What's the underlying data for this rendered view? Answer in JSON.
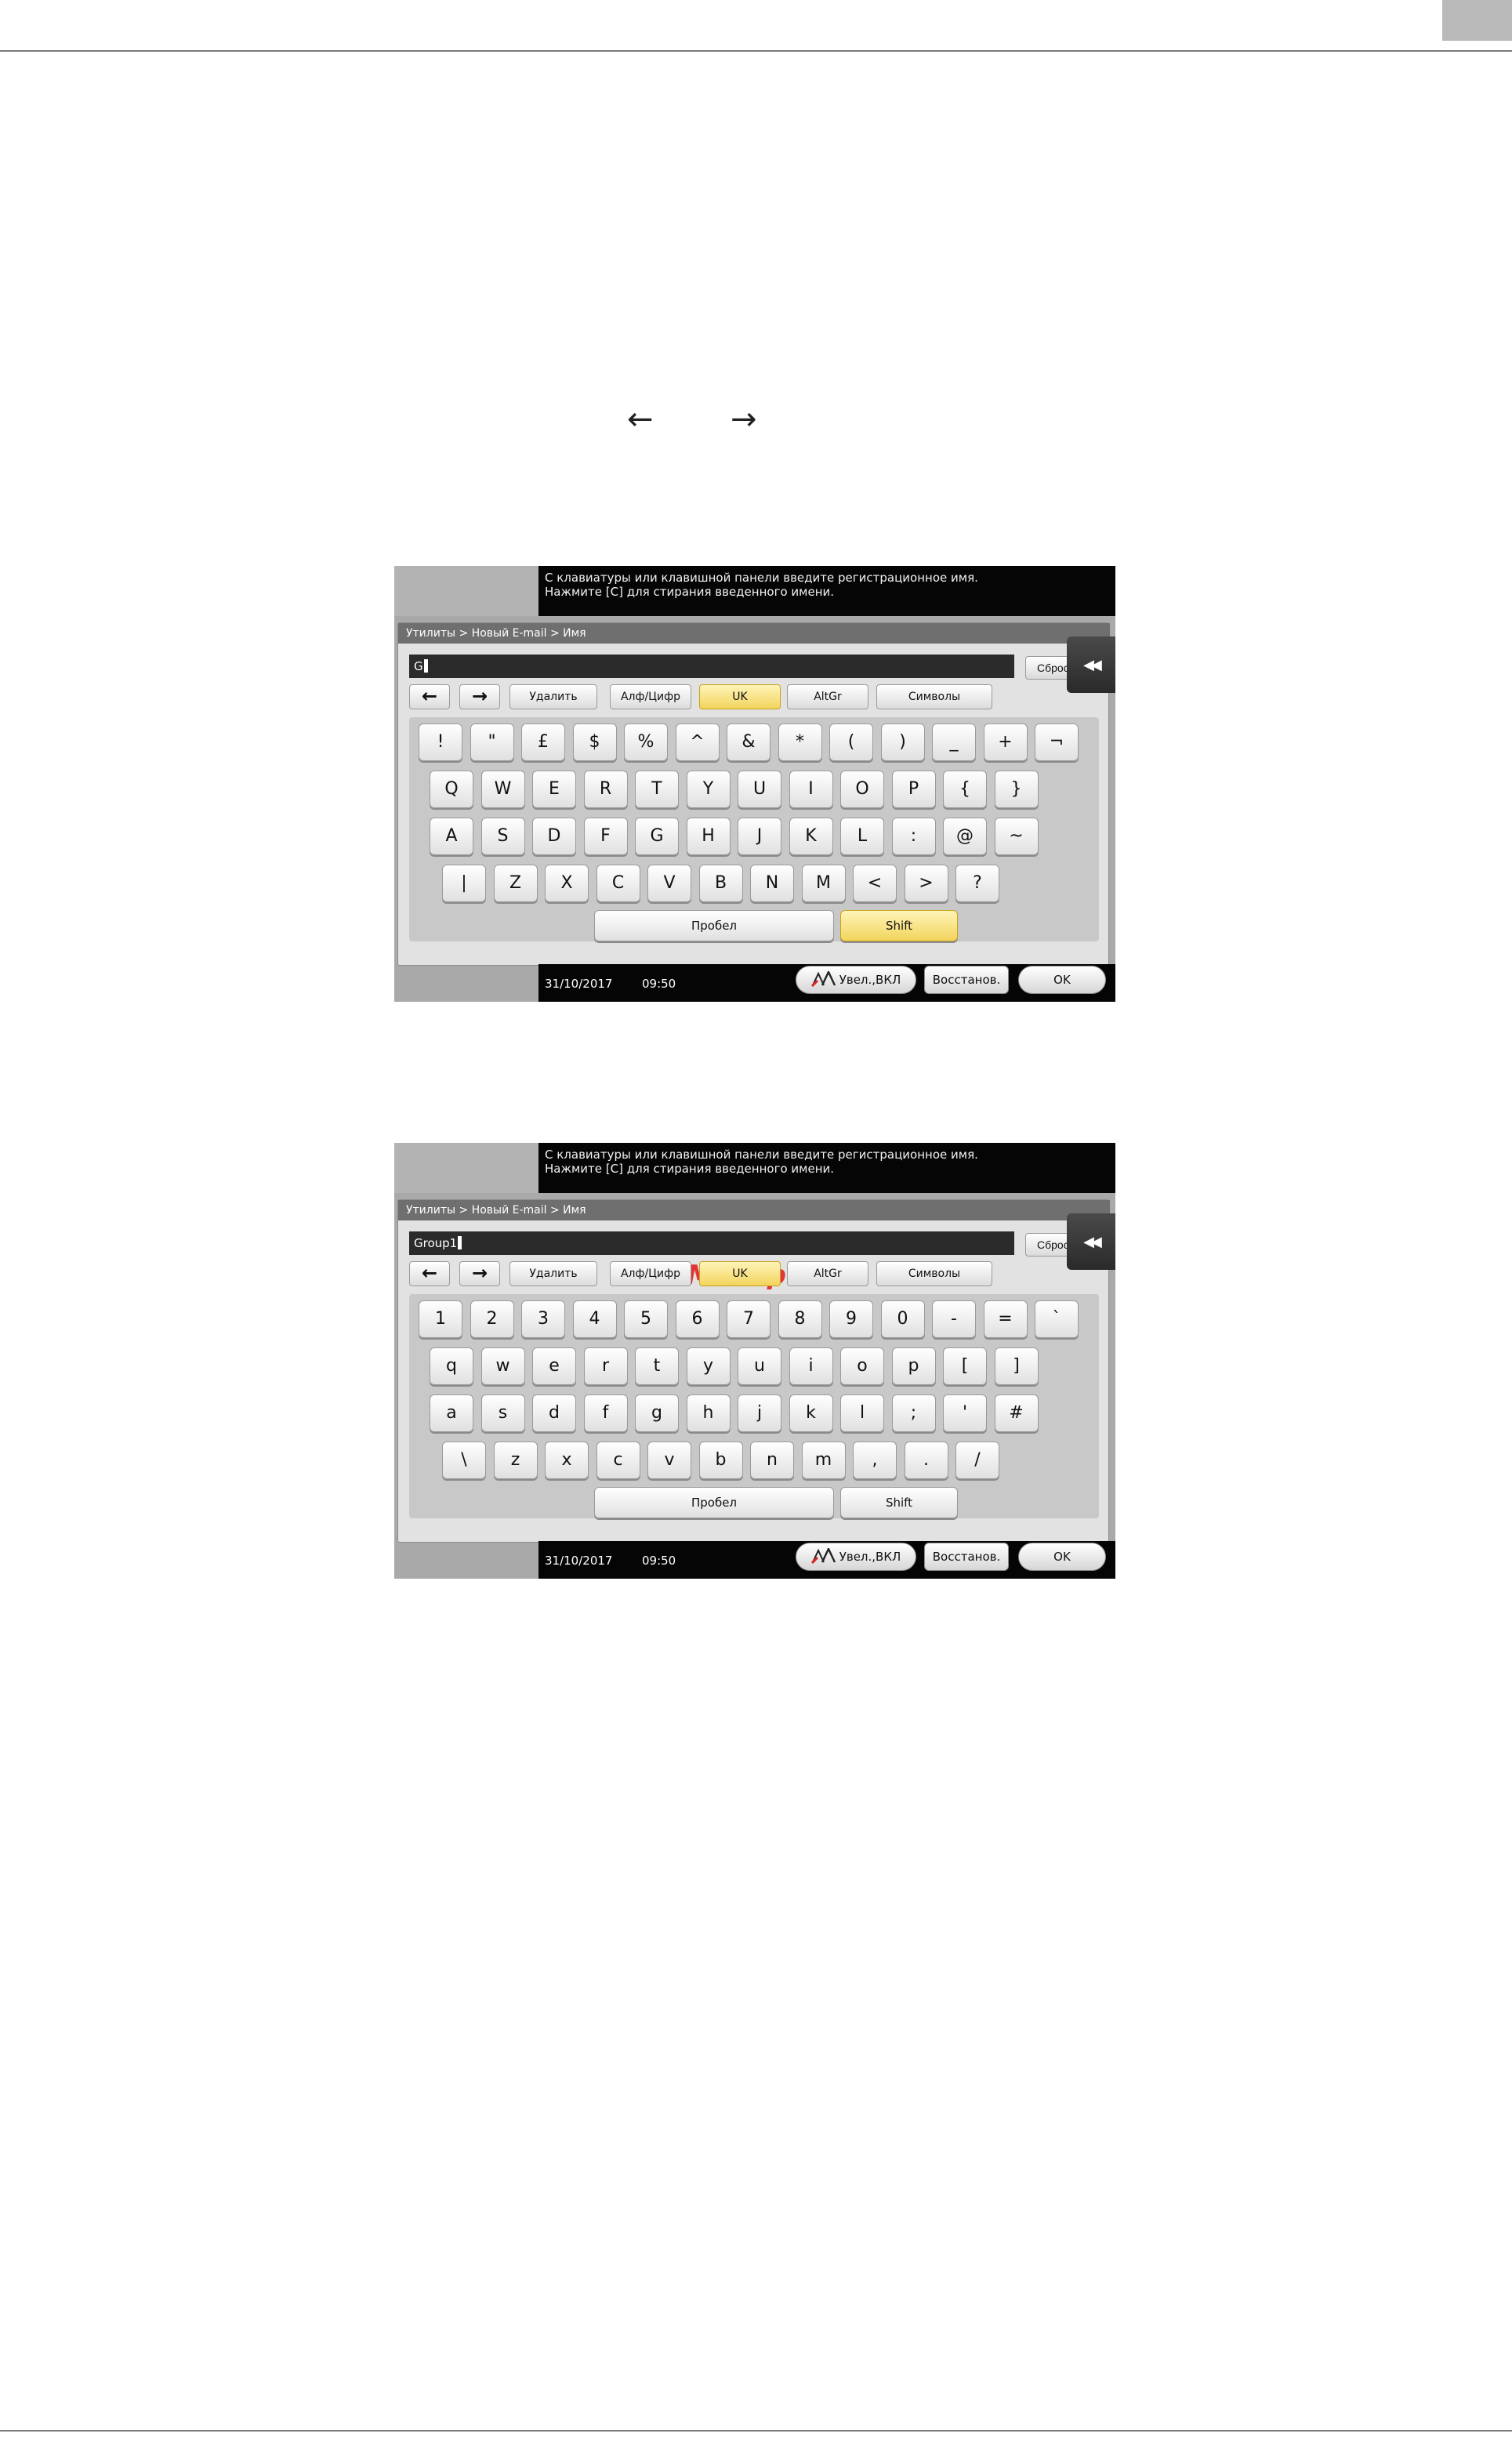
{
  "page": {
    "arrows": {
      "left": "←",
      "right": "→"
    }
  },
  "screens": [
    {
      "message_line1": "С клавиатуры или клавишной панели введите регистрационное имя.",
      "message_line2": "Нажмите [C] для стирания введенного имени.",
      "breadcrumb": "Утилиты > Новый E-mail > Имя",
      "field_value": "G",
      "reset_label": "Сброс",
      "collapse_icon": "rewind-icon",
      "mode_buttons": {
        "left": "←",
        "right": "→",
        "delete": "Удалить",
        "alnum": "Алф/Цифр",
        "uk": "UK",
        "altgr": "AltGr",
        "symbols": "Символы"
      },
      "active_mode": "UK",
      "rows": [
        [
          "!",
          "\"",
          "£",
          "$",
          "%",
          "^",
          "&",
          "*",
          "(",
          ")",
          "_",
          "+",
          "¬"
        ],
        [
          "Q",
          "W",
          "E",
          "R",
          "T",
          "Y",
          "U",
          "I",
          "O",
          "P",
          "{",
          "}"
        ],
        [
          "A",
          "S",
          "D",
          "F",
          "G",
          "H",
          "J",
          "K",
          "L",
          ":",
          "@",
          "~"
        ],
        [
          "|",
          "Z",
          "X",
          "C",
          "V",
          "B",
          "N",
          "M",
          "<",
          ">",
          "?"
        ]
      ],
      "space_label": "Пробел",
      "shift_label": "Shift",
      "shift_active": true,
      "date": "31/10/2017",
      "time": "09:50",
      "zoom_label": "Увел.,ВКЛ",
      "restore_label": "Восстанов.",
      "ok_label": "OK"
    },
    {
      "message_line1": "С клавиатуры или клавишной панели введите регистрационное имя.",
      "message_line2": "Нажмите [C] для стирания введенного имени.",
      "breadcrumb": "Утилиты > Новый E-mail > Имя",
      "watermark": "McGrp.Ru",
      "field_value": "Group1",
      "reset_label": "Сброс",
      "collapse_icon": "rewind-icon",
      "mode_buttons": {
        "left": "←",
        "right": "→",
        "delete": "Удалить",
        "alnum": "Алф/Цифр",
        "uk": "UK",
        "altgr": "AltGr",
        "symbols": "Символы"
      },
      "active_mode": "UK",
      "rows": [
        [
          "1",
          "2",
          "3",
          "4",
          "5",
          "6",
          "7",
          "8",
          "9",
          "0",
          "-",
          "=",
          "`"
        ],
        [
          "q",
          "w",
          "e",
          "r",
          "t",
          "y",
          "u",
          "i",
          "o",
          "p",
          "[",
          "]"
        ],
        [
          "a",
          "s",
          "d",
          "f",
          "g",
          "h",
          "j",
          "k",
          "l",
          ";",
          "'",
          "#"
        ],
        [
          "\\",
          "z",
          "x",
          "c",
          "v",
          "b",
          "n",
          "m",
          ",",
          ".",
          "/"
        ]
      ],
      "space_label": "Пробел",
      "shift_label": "Shift",
      "shift_active": false,
      "date": "31/10/2017",
      "time": "09:50",
      "zoom_label": "Увел.,ВКЛ",
      "restore_label": "Восстанов.",
      "ok_label": "OK"
    }
  ]
}
